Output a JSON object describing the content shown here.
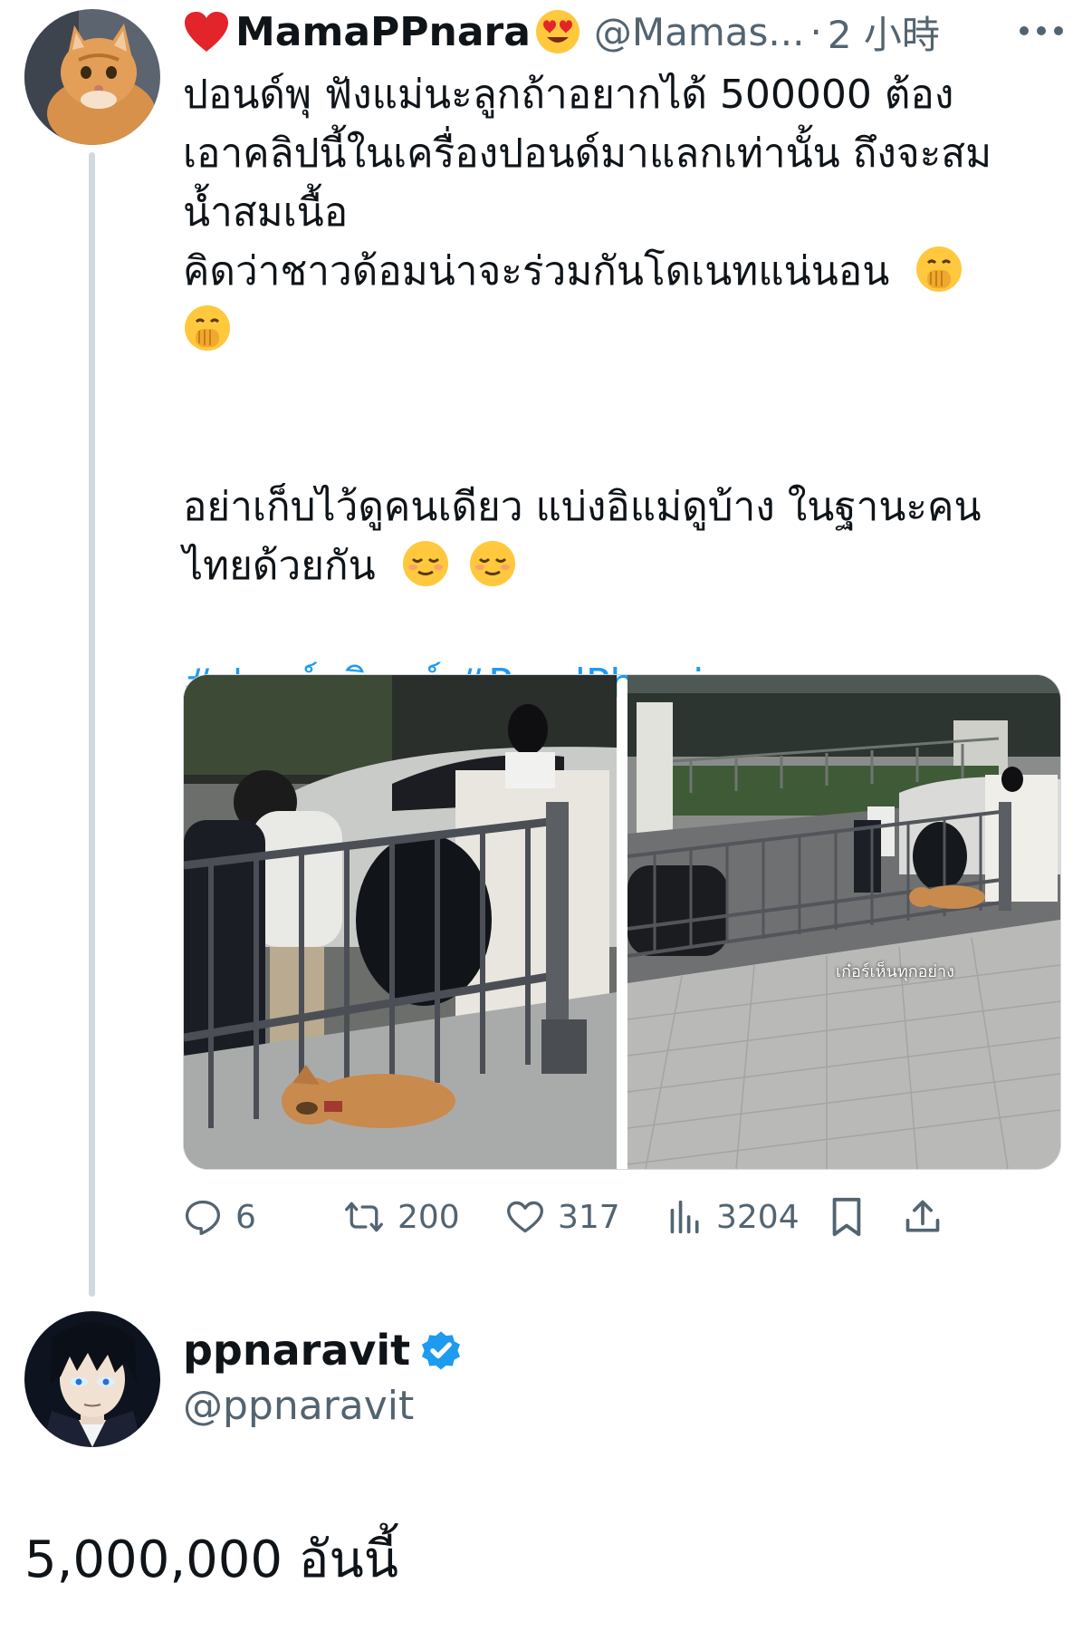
{
  "tweet": {
    "display_name": "MamaPPnara",
    "handle": "@Mamas...",
    "dot": "·",
    "time": "2 小時",
    "body_lines": [
      "ปอนด์พุ ฟังแม่นะลูกถ้าอยากได้ 500000 ต้อง",
      "เอาคลิปนี้ในเครื่องปอนด์มาแลกเท่านั้น ถึงจะสม",
      "น้ำสมเนื้อ",
      "คิดว่าชาวด้อมน่าจะร่วมกันโดเนทแน่นอน",
      "อย่าเก็บไว้ดูคนเดียว แบ่งอิแม่ดูบ้าง ในฐานะคน",
      "ไทยด้วยกัน"
    ],
    "hashtags": "#ปอนด์ภูวินทร์ #PondPhuwin",
    "image2_caption": "เก๋อร์เห็นทุกอย่าง",
    "replies": "6",
    "retweets": "200",
    "likes": "317",
    "views": "3204"
  },
  "reply": {
    "display_name": "ppnaravit",
    "handle": "@ppnaravit",
    "text": "5,000,000 อันนี้"
  },
  "colors": {
    "accent": "#1d9bf0",
    "secondary_text": "#536471",
    "thread_line": "#cfd9de"
  },
  "icons": [
    "heart-emoji",
    "heart-eyes-emoji",
    "more-icon",
    "hand-over-mouth-emoji",
    "relieved-emoji",
    "reply-icon",
    "retweet-icon",
    "like-icon",
    "views-icon",
    "bookmark-icon",
    "share-icon",
    "verified-badge-icon"
  ]
}
